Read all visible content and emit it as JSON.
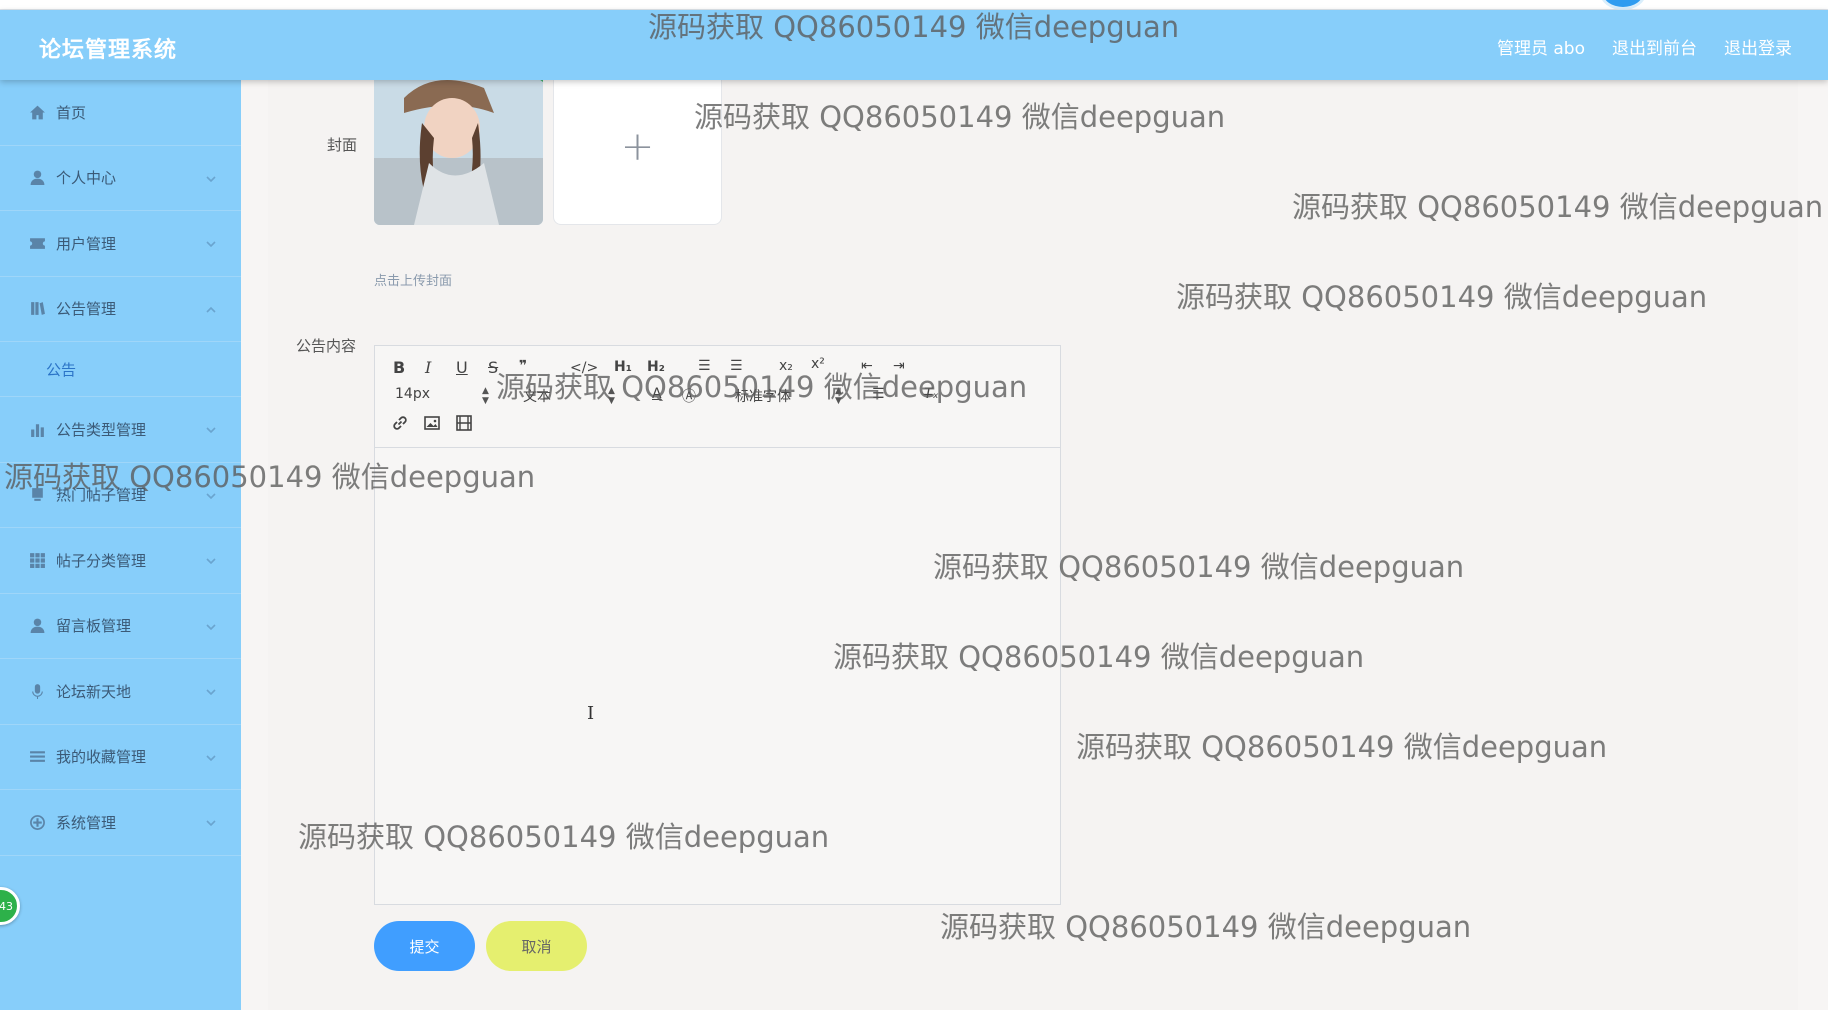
{
  "header": {
    "brand": "论坛管理系统",
    "admin_label": "管理员 abo",
    "exit_front_label": "退出到前台",
    "logout_label": "退出登录"
  },
  "sidebar": {
    "items": [
      {
        "label": "首页",
        "icon": "home-icon",
        "has_arrow": false
      },
      {
        "label": "个人中心",
        "icon": "user-icon",
        "has_arrow": true
      },
      {
        "label": "用户管理",
        "icon": "ticket-icon",
        "has_arrow": true
      },
      {
        "label": "公告管理",
        "icon": "book-icon",
        "has_arrow": true,
        "expanded": true
      },
      {
        "label": "公告",
        "sub": true
      },
      {
        "label": "公告类型管理",
        "icon": "bar-chart-icon",
        "has_arrow": true
      },
      {
        "label": "热门帖子管理",
        "icon": "bell-icon",
        "has_arrow": true
      },
      {
        "label": "帖子分类管理",
        "icon": "grid-icon",
        "has_arrow": true
      },
      {
        "label": "留言板管理",
        "icon": "person-icon",
        "has_arrow": true
      },
      {
        "label": "论坛新天地",
        "icon": "microphone-icon",
        "has_arrow": true
      },
      {
        "label": "我的收藏管理",
        "icon": "list-icon",
        "has_arrow": true
      },
      {
        "label": "系统管理",
        "icon": "compass-icon",
        "has_arrow": true
      }
    ],
    "floating_badge": "43"
  },
  "form": {
    "cover_label": "封面",
    "upload_tip": "点击上传封面",
    "content_label": "公告内容",
    "font_size_value": "14px",
    "text_style_value": "文本",
    "font_family_value": "标准字体",
    "submit_label": "提交",
    "cancel_label": "取消"
  },
  "watermarks": [
    "源码获取 QQ86050149 微信deepguan",
    "源码获取 QQ86050149 微信deepguan",
    "源码获取 QQ86050149 微信deepguan",
    "源码获取 QQ86050149 微信deepguan",
    "源码获取 QQ86050149 微信deepguan",
    "源码获取 QQ86050149 微信deepguan",
    "源码获取 QQ86050149 微信deepguan",
    "源码获取 QQ86050149 微信deepguan",
    "源码获取 QQ86050149 微信deepguan",
    "源码获取 QQ86050149 微信deepguan",
    "源码获取 QQ86050149 微信deepguan"
  ],
  "colors": {
    "header": "#87cefa",
    "sidebar": "#87cefa",
    "primary_button": "#409eff",
    "cancel_button": "#e5ef6f"
  }
}
